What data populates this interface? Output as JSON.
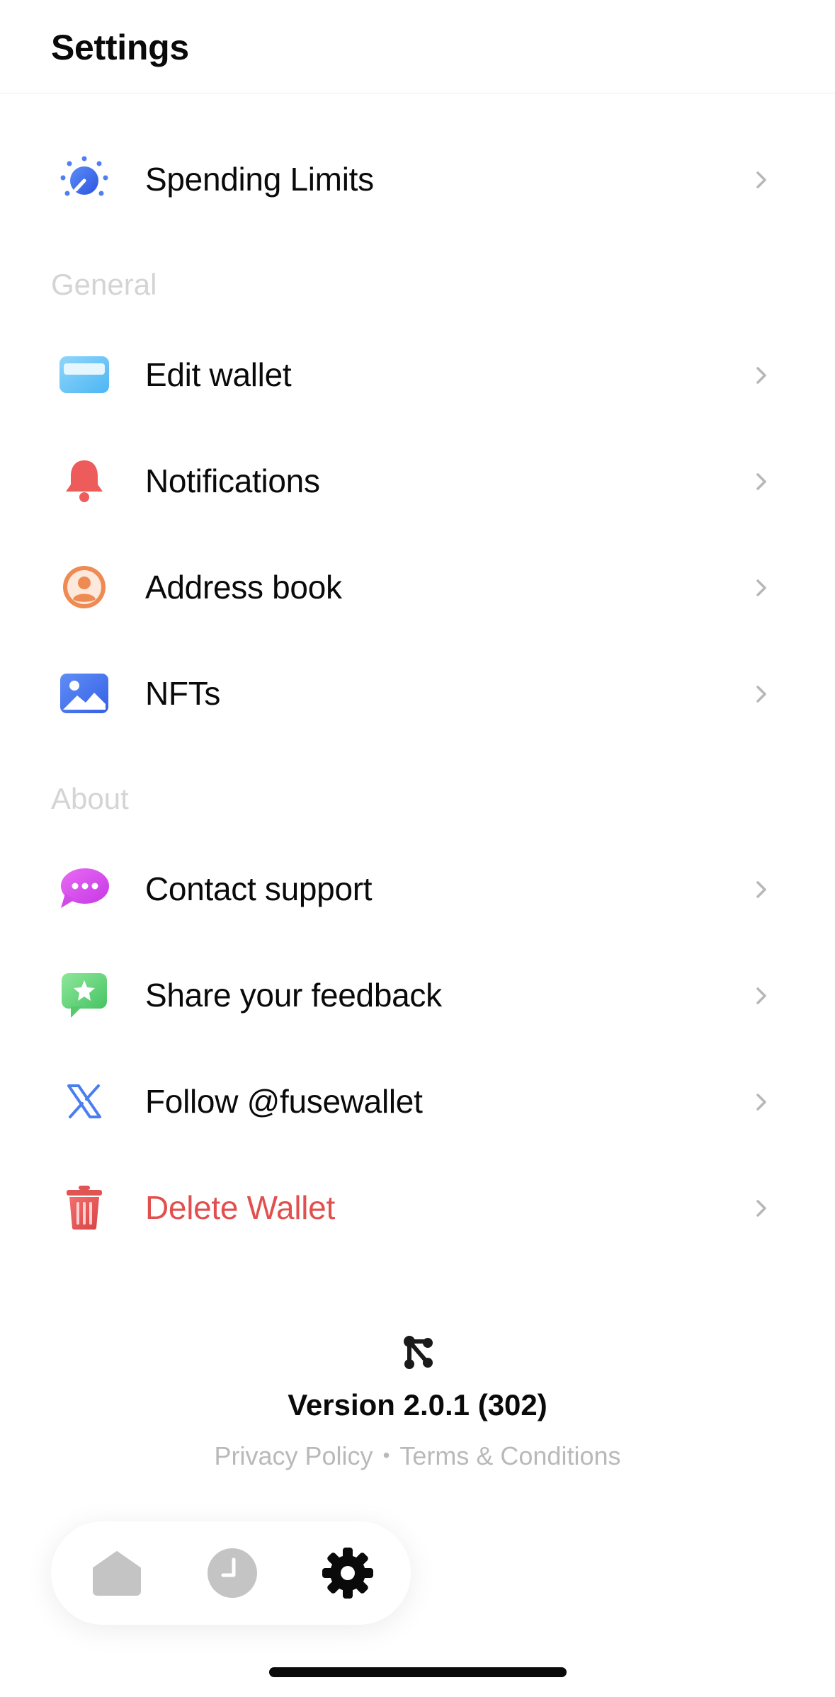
{
  "header": {
    "title": "Settings"
  },
  "rows_top": [
    {
      "label": "Spending Limits",
      "icon": "gauge-icon"
    }
  ],
  "sections": {
    "general": "General",
    "about": "About"
  },
  "general_rows": [
    {
      "label": "Edit wallet",
      "icon": "wallet-card-icon"
    },
    {
      "label": "Notifications",
      "icon": "bell-icon"
    },
    {
      "label": "Address book",
      "icon": "contact-icon"
    },
    {
      "label": "NFTs",
      "icon": "image-icon"
    }
  ],
  "about_rows": [
    {
      "label": "Contact support",
      "icon": "chat-bubble-icon"
    },
    {
      "label": "Share your feedback",
      "icon": "feedback-star-icon"
    },
    {
      "label": "Follow @fusewallet",
      "icon": "x-logo-icon"
    },
    {
      "label": "Delete Wallet",
      "icon": "trash-icon"
    }
  ],
  "footer": {
    "version": "Version 2.0.1 (302)",
    "privacy": "Privacy Policy",
    "separator": "•",
    "terms": "Terms & Conditions"
  },
  "tabs": [
    {
      "name": "home",
      "icon": "home-icon",
      "active": false
    },
    {
      "name": "history",
      "icon": "clock-icon",
      "active": false
    },
    {
      "name": "settings",
      "icon": "gear-icon",
      "active": true
    }
  ],
  "colors": {
    "accent_blue": "#3b6ff0",
    "danger": "#e0504f",
    "section_label": "#d4d4d4",
    "link_gray": "#b9b9b9"
  }
}
